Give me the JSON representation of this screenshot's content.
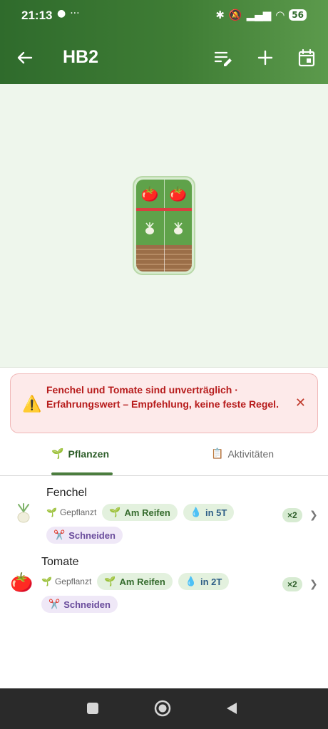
{
  "status_bar": {
    "time": "21:13",
    "battery": "56"
  },
  "app_bar": {
    "title": "HB2"
  },
  "bed": {
    "rows": [
      {
        "plant": "Tomate",
        "emoji": "🍅",
        "cells": 2
      },
      {
        "plant": "Fenchel",
        "emoji": "🧅",
        "cells": 2
      }
    ]
  },
  "warning": {
    "text": "Fenchel und Tomate sind unverträglich · Erfahrungswert – Empfehlung, keine feste Regel."
  },
  "tabs": [
    {
      "label": "Pflanzen",
      "icon": "🌱",
      "active": true
    },
    {
      "label": "Aktivitäten",
      "icon": "📋",
      "active": false
    }
  ],
  "plants": [
    {
      "name": "Fenchel",
      "icon": "fennel-icon",
      "status": "Gepflanzt",
      "chips": [
        "Am Reifen",
        "in 5T",
        "Schneiden"
      ],
      "count": "×2"
    },
    {
      "name": "Tomate",
      "icon": "tomato-icon",
      "status": "Gepflanzt",
      "chips": [
        "Am Reifen",
        "in 2T",
        "Schneiden"
      ],
      "count": "×2"
    }
  ],
  "colors": {
    "appbar": "#3f7d35",
    "warning_bg": "#fdeaea",
    "warning_text": "#b71c1c",
    "accent": "#4b7d3e"
  }
}
